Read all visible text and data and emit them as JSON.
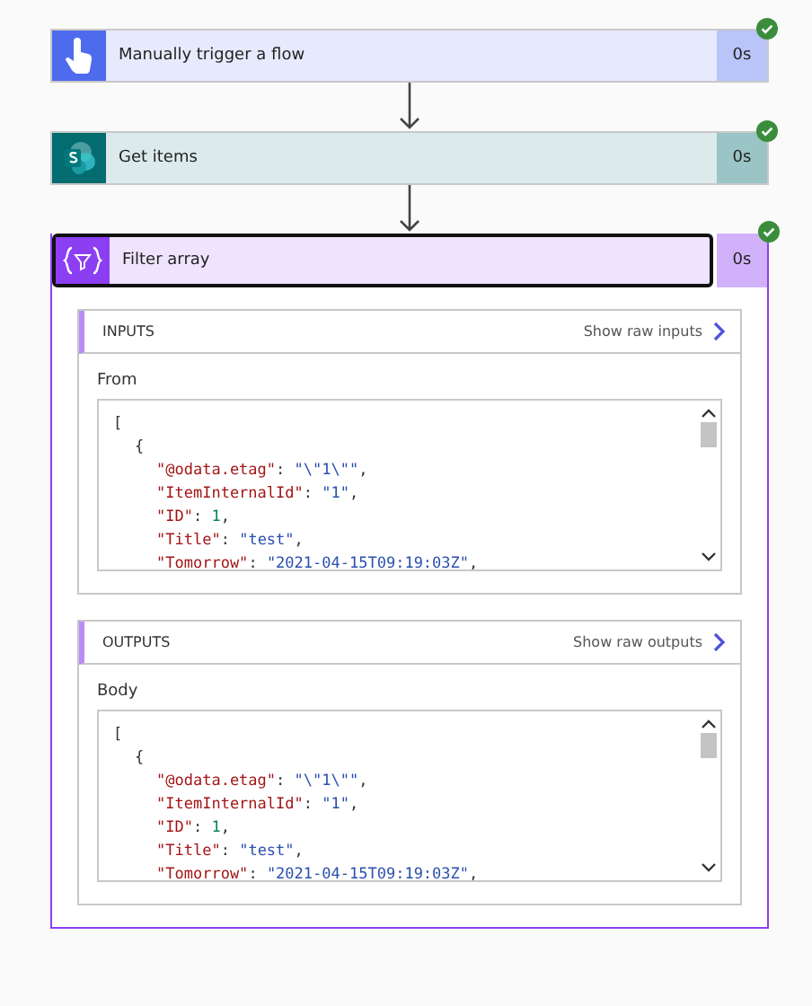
{
  "steps": [
    {
      "title": "Manually trigger a flow",
      "duration": "0s",
      "kind": "trigger",
      "color": "#4f6bed",
      "succeeded": true,
      "selected": false,
      "expanded": false
    },
    {
      "title": "Get items",
      "duration": "0s",
      "kind": "sharepoint",
      "color": "#036c70",
      "succeeded": true,
      "selected": false,
      "expanded": false
    },
    {
      "title": "Filter array",
      "duration": "0s",
      "kind": "filter",
      "color": "#8c3ff2",
      "succeeded": true,
      "selected": true,
      "expanded": true,
      "sections": [
        {
          "label": "INPUTS",
          "link": "Show raw inputs",
          "field_label": "From",
          "lines": [
            {
              "tokens": [
                {
                  "kind": "bracket",
                  "text": "["
                }
              ],
              "children": [
                {
                  "tokens": [
                    {
                      "kind": "punct",
                      "text": "{"
                    }
                  ],
                  "children": [
                    {
                      "tokens": [
                        {
                          "kind": "key",
                          "text": "\"@odata.etag\""
                        },
                        {
                          "kind": "punct",
                          "text": ": "
                        },
                        {
                          "kind": "string",
                          "text": "\"\\\"1\\\"\""
                        },
                        {
                          "kind": "punct",
                          "text": ","
                        }
                      ]
                    },
                    {
                      "tokens": [
                        {
                          "kind": "key",
                          "text": "\"ItemInternalId\""
                        },
                        {
                          "kind": "punct",
                          "text": ": "
                        },
                        {
                          "kind": "string",
                          "text": "\"1\""
                        },
                        {
                          "kind": "punct",
                          "text": ","
                        }
                      ]
                    },
                    {
                      "tokens": [
                        {
                          "kind": "key",
                          "text": "\"ID\""
                        },
                        {
                          "kind": "punct",
                          "text": ": "
                        },
                        {
                          "kind": "number",
                          "text": "1"
                        },
                        {
                          "kind": "punct",
                          "text": ","
                        }
                      ]
                    },
                    {
                      "tokens": [
                        {
                          "kind": "key",
                          "text": "\"Title\""
                        },
                        {
                          "kind": "punct",
                          "text": ": "
                        },
                        {
                          "kind": "string",
                          "text": "\"test\""
                        },
                        {
                          "kind": "punct",
                          "text": ","
                        }
                      ]
                    },
                    {
                      "tokens": [
                        {
                          "kind": "key",
                          "text": "\"Tomorrow\""
                        },
                        {
                          "kind": "punct",
                          "text": ": "
                        },
                        {
                          "kind": "string",
                          "text": "\"2021-04-15T09:19:03Z\""
                        },
                        {
                          "kind": "punct",
                          "text": ","
                        }
                      ]
                    }
                  ]
                }
              ]
            }
          ]
        },
        {
          "label": "OUTPUTS",
          "link": "Show raw outputs",
          "field_label": "Body",
          "lines": [
            {
              "tokens": [
                {
                  "kind": "bracket",
                  "text": "["
                }
              ],
              "children": [
                {
                  "tokens": [
                    {
                      "kind": "punct",
                      "text": "{"
                    }
                  ],
                  "children": [
                    {
                      "tokens": [
                        {
                          "kind": "key",
                          "text": "\"@odata.etag\""
                        },
                        {
                          "kind": "punct",
                          "text": ": "
                        },
                        {
                          "kind": "string",
                          "text": "\"\\\"1\\\"\""
                        },
                        {
                          "kind": "punct",
                          "text": ","
                        }
                      ]
                    },
                    {
                      "tokens": [
                        {
                          "kind": "key",
                          "text": "\"ItemInternalId\""
                        },
                        {
                          "kind": "punct",
                          "text": ": "
                        },
                        {
                          "kind": "string",
                          "text": "\"1\""
                        },
                        {
                          "kind": "punct",
                          "text": ","
                        }
                      ]
                    },
                    {
                      "tokens": [
                        {
                          "kind": "key",
                          "text": "\"ID\""
                        },
                        {
                          "kind": "punct",
                          "text": ": "
                        },
                        {
                          "kind": "number",
                          "text": "1"
                        },
                        {
                          "kind": "punct",
                          "text": ","
                        }
                      ]
                    },
                    {
                      "tokens": [
                        {
                          "kind": "key",
                          "text": "\"Title\""
                        },
                        {
                          "kind": "punct",
                          "text": ": "
                        },
                        {
                          "kind": "string",
                          "text": "\"test\""
                        },
                        {
                          "kind": "punct",
                          "text": ","
                        }
                      ]
                    },
                    {
                      "tokens": [
                        {
                          "kind": "key",
                          "text": "\"Tomorrow\""
                        },
                        {
                          "kind": "punct",
                          "text": ": "
                        },
                        {
                          "kind": "string",
                          "text": "\"2021-04-15T09:19:03Z\""
                        },
                        {
                          "kind": "punct",
                          "text": ","
                        }
                      ]
                    }
                  ]
                }
              ]
            }
          ]
        }
      ]
    }
  ]
}
